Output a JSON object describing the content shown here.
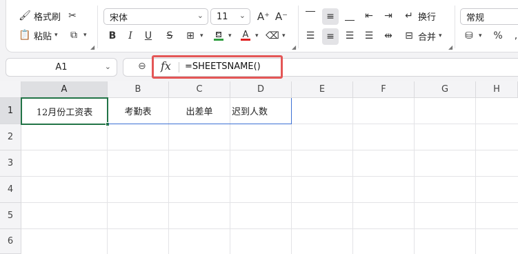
{
  "ribbon": {
    "format_painter": "格式刷",
    "paste": "粘贴",
    "font_name": "宋体",
    "font_size": "11",
    "bold": "B",
    "italic": "I",
    "underline": "U",
    "wrap_text": "换行",
    "merge": "合并",
    "number_format": "常规",
    "percent": "%",
    "font_color_accent": "#e02020",
    "fill_color_accent": "#2e9e3e"
  },
  "formula_bar": {
    "name_box": "A1",
    "fx": "fx",
    "formula": "=SHEETSNAME()"
  },
  "sheet": {
    "columns": [
      "A",
      "B",
      "C",
      "D",
      "E",
      "F",
      "G",
      "H"
    ],
    "rows": [
      "1",
      "2",
      "3",
      "4",
      "5",
      "6"
    ],
    "row1": [
      "12月份工资表",
      "考勤表",
      "出差单",
      "迟到人数"
    ]
  },
  "colors": {
    "selection": "#217346",
    "highlight_box": "#e45656"
  }
}
